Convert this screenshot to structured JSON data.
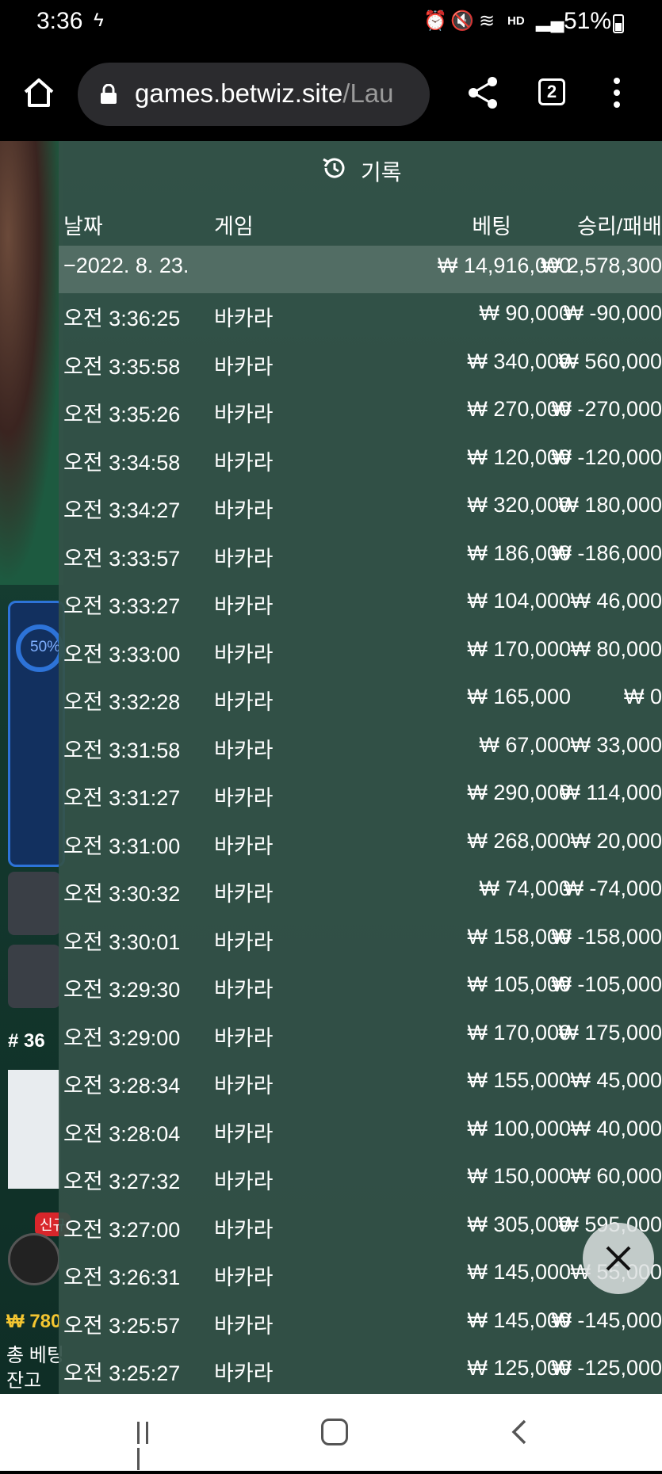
{
  "status_bar": {
    "time": "3:36",
    "battery": "51%"
  },
  "browser": {
    "url_host": "games.betwiz.site",
    "url_path": "/Lau",
    "tab_count": "2"
  },
  "background": {
    "percent": "50%",
    "round": "# 36",
    "new_badge": "신규",
    "balance_amount": "₩ 780",
    "total_bet_label": "총 베팅",
    "balance_label": "잔고"
  },
  "history": {
    "title": "기록",
    "headers": {
      "date": "날짜",
      "game": "게임",
      "bet": "베팅",
      "result": "승리/패배"
    },
    "date_row": {
      "date": "−2022. 8. 23.",
      "bet": "₩ 14,916,000",
      "result": "₩ 2,578,300"
    },
    "rows": [
      {
        "time": "오전 3:36:25",
        "game": "바카라",
        "bet": "₩ 90,000",
        "result": "₩ -90,000"
      },
      {
        "time": "오전 3:35:58",
        "game": "바카라",
        "bet": "₩ 340,000",
        "result": "₩ 560,000"
      },
      {
        "time": "오전 3:35:26",
        "game": "바카라",
        "bet": "₩ 270,000",
        "result": "₩ -270,000"
      },
      {
        "time": "오전 3:34:58",
        "game": "바카라",
        "bet": "₩ 120,000",
        "result": "₩ -120,000"
      },
      {
        "time": "오전 3:34:27",
        "game": "바카라",
        "bet": "₩ 320,000",
        "result": "₩ 180,000"
      },
      {
        "time": "오전 3:33:57",
        "game": "바카라",
        "bet": "₩ 186,000",
        "result": "₩ -186,000"
      },
      {
        "time": "오전 3:33:27",
        "game": "바카라",
        "bet": "₩ 104,000",
        "result": "₩ 46,000"
      },
      {
        "time": "오전 3:33:00",
        "game": "바카라",
        "bet": "₩ 170,000",
        "result": "₩ 80,000"
      },
      {
        "time": "오전 3:32:28",
        "game": "바카라",
        "bet": "₩ 165,000",
        "result": "₩ 0"
      },
      {
        "time": "오전 3:31:58",
        "game": "바카라",
        "bet": "₩ 67,000",
        "result": "₩ 33,000"
      },
      {
        "time": "오전 3:31:27",
        "game": "바카라",
        "bet": "₩ 290,000",
        "result": "₩ 114,000"
      },
      {
        "time": "오전 3:31:00",
        "game": "바카라",
        "bet": "₩ 268,000",
        "result": "₩ 20,000"
      },
      {
        "time": "오전 3:30:32",
        "game": "바카라",
        "bet": "₩ 74,000",
        "result": "₩ -74,000"
      },
      {
        "time": "오전 3:30:01",
        "game": "바카라",
        "bet": "₩ 158,000",
        "result": "₩ -158,000"
      },
      {
        "time": "오전 3:29:30",
        "game": "바카라",
        "bet": "₩ 105,000",
        "result": "₩ -105,000"
      },
      {
        "time": "오전 3:29:00",
        "game": "바카라",
        "bet": "₩ 170,000",
        "result": "₩ 175,000"
      },
      {
        "time": "오전 3:28:34",
        "game": "바카라",
        "bet": "₩ 155,000",
        "result": "₩ 45,000"
      },
      {
        "time": "오전 3:28:04",
        "game": "바카라",
        "bet": "₩ 100,000",
        "result": "₩ 40,000"
      },
      {
        "time": "오전 3:27:32",
        "game": "바카라",
        "bet": "₩ 150,000",
        "result": "₩ 60,000"
      },
      {
        "time": "오전 3:27:00",
        "game": "바카라",
        "bet": "₩ 305,000",
        "result": "₩ 595,000"
      },
      {
        "time": "오전 3:26:31",
        "game": "바카라",
        "bet": "₩ 145,000",
        "result": "₩ 55,000"
      },
      {
        "time": "오전 3:25:57",
        "game": "바카라",
        "bet": "₩ 145,000",
        "result": "₩ -145,000"
      },
      {
        "time": "오전 3:25:27",
        "game": "바카라",
        "bet": "₩ 125,000",
        "result": "₩ -125,000"
      }
    ]
  },
  "icons": {
    "home": "home-icon",
    "lock": "lock-icon",
    "share": "share-icon",
    "menu": "more-vert-icon",
    "history": "history-icon",
    "close": "close-icon"
  }
}
